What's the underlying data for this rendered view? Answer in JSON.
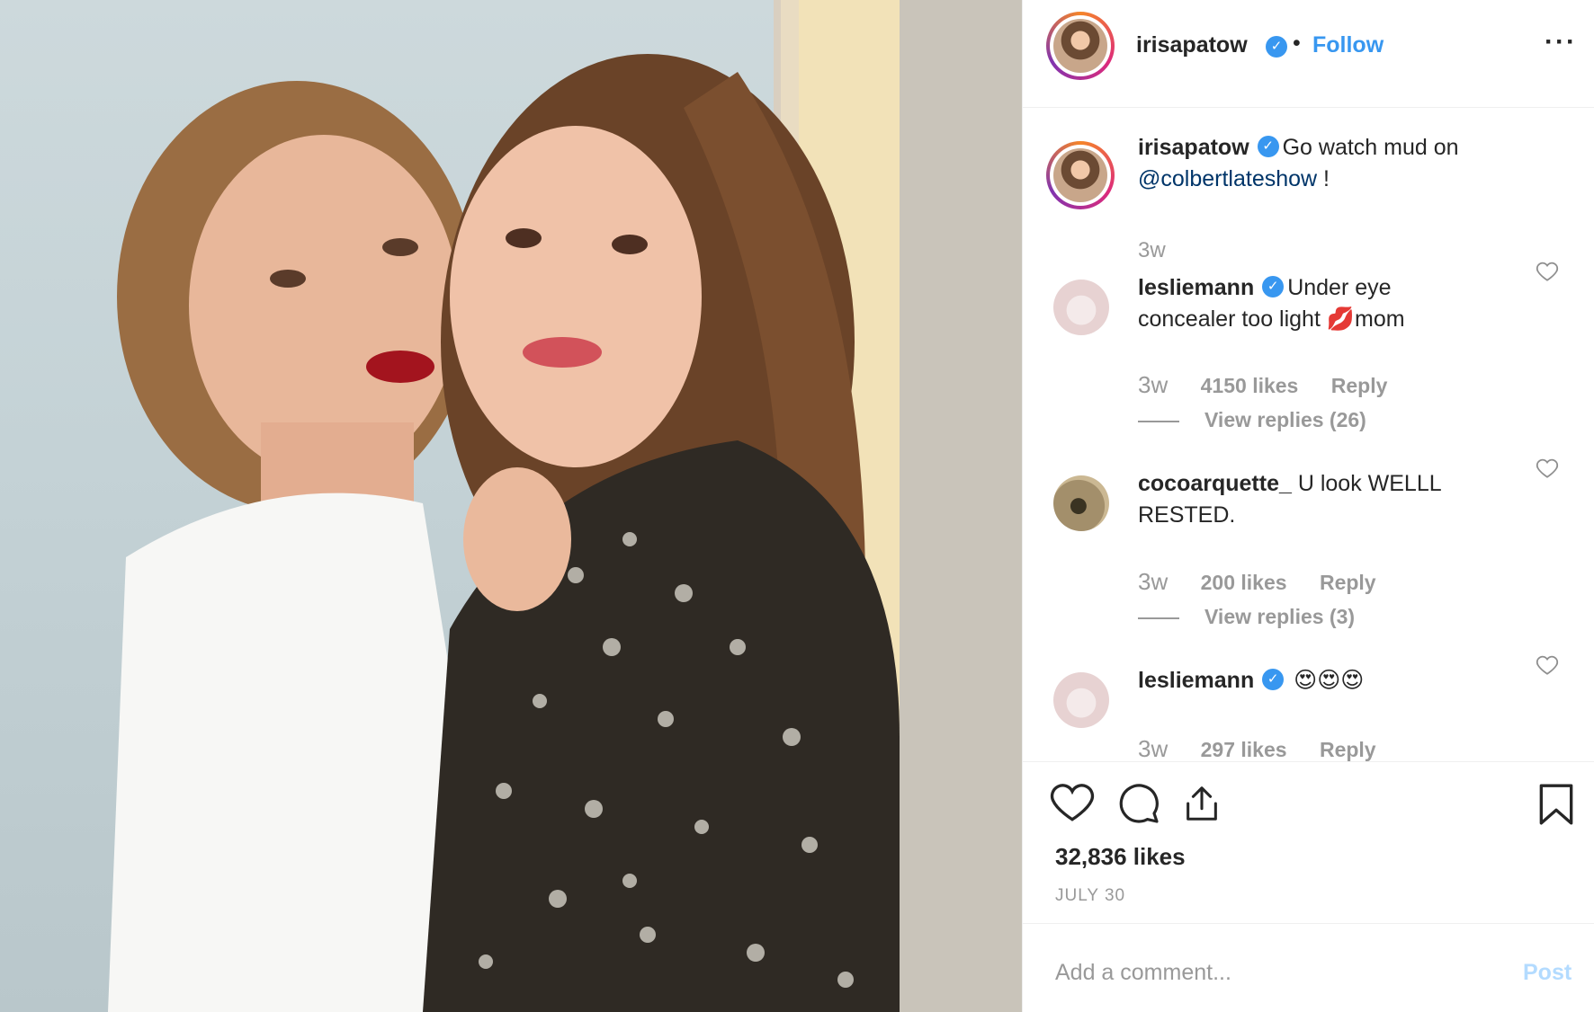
{
  "post": {
    "username": "irisapatow",
    "separator": "•",
    "follow_label": "Follow",
    "more_label": "···"
  },
  "caption": {
    "username": "irisapatow",
    "text": "Go watch mud on",
    "mention": "@colbertlateshow",
    "suffix": " !",
    "time": "3w"
  },
  "comments": [
    {
      "username": "lesliemann",
      "verified": true,
      "text": "Under eye concealer too light",
      "emoji": "💋",
      "text_after": "mom",
      "time": "3w",
      "likes": "4150 likes",
      "reply_label": "Reply",
      "view_replies": "View replies (26)"
    },
    {
      "username": "cocoarquette_",
      "verified": false,
      "text": "U look WELLL RESTED.",
      "time": "3w",
      "likes": "200 likes",
      "reply_label": "Reply",
      "view_replies": "View replies (3)"
    },
    {
      "username": "lesliemann",
      "verified": true,
      "text": "😍😍😍",
      "time": "3w",
      "likes": "297 likes",
      "reply_label": "Reply"
    }
  ],
  "footer": {
    "likes": "32,836 likes",
    "date": "JULY 30"
  },
  "composer": {
    "placeholder": "Add a comment...",
    "post_label": "Post"
  },
  "icons": {
    "verified": "verified-badge-icon",
    "like": "heart-icon",
    "comment": "comment-bubble-icon",
    "share": "share-icon",
    "save": "bookmark-icon"
  },
  "colors": {
    "accent": "#3897f0",
    "mention": "#003569",
    "muted": "#999999",
    "post_disabled": "#b3dbff"
  }
}
